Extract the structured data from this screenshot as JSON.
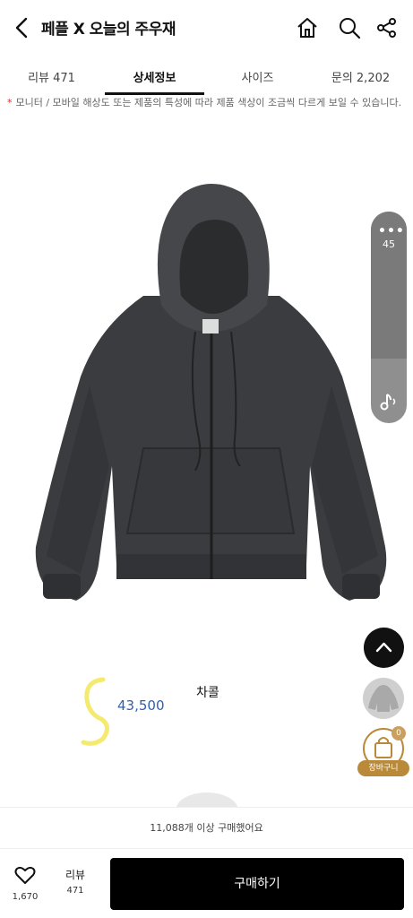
{
  "header": {
    "title": "페플 X 오늘의 주우재",
    "icons": [
      "back-arrow-icon",
      "home-icon",
      "search-icon",
      "share-icon"
    ]
  },
  "tabs": [
    {
      "label": "리뷰 471",
      "active": false
    },
    {
      "label": "상세정보",
      "active": true
    },
    {
      "label": "사이즈",
      "active": false
    },
    {
      "label": "문의 2,202",
      "active": false
    }
  ],
  "notice": {
    "star": "*",
    "text": "모니터 / 모바일 해상도 또는 제품의 특성에 따라 제품 색상이 조금씩 다르게 보일 수 있습니다."
  },
  "side_controls": {
    "dots": "•••",
    "count": "45"
  },
  "cart": {
    "badge": "0",
    "label": "장바구니"
  },
  "product": {
    "color_name": "차콜",
    "price": "43,500"
  },
  "purchase_info": "11,088개 이상 구매했어요",
  "bottom_bar": {
    "likes": "1,670",
    "review_label": "리뷰",
    "review_count": "471",
    "buy_label": "구매하기"
  }
}
